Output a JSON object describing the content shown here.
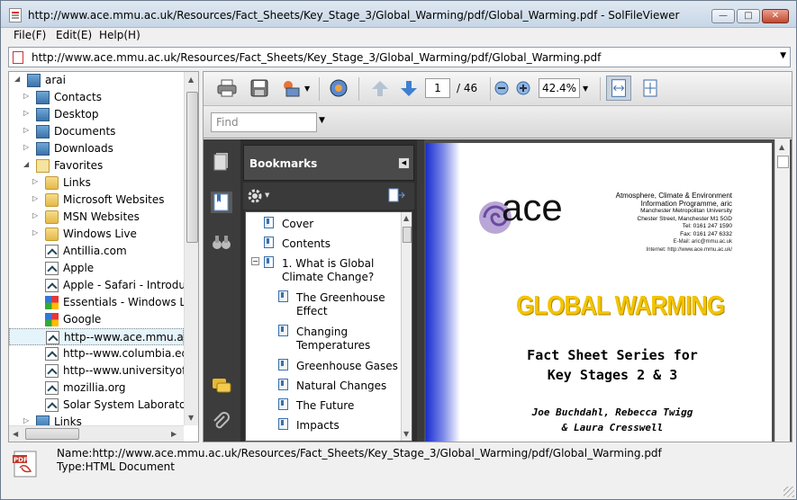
{
  "window": {
    "title": "http://www.ace.mmu.ac.uk/Resources/Fact_Sheets/Key_Stage_3/Global_Warming/pdf/Global_Warming.pdf - SolFileViewer"
  },
  "menu": [
    "File(F)",
    "Edit(E)",
    "Help(H)"
  ],
  "address": {
    "value": "http://www.ace.mmu.ac.uk/Resources/Fact_Sheets/Key_Stage_3/Global_Warming/pdf/Global_Warming.pdf"
  },
  "tree": {
    "items": [
      {
        "label": "arai",
        "icon": "user-icon"
      },
      {
        "label": "Contacts",
        "icon": "contacts-folder-icon"
      },
      {
        "label": "Desktop",
        "icon": "desktop-folder-icon"
      },
      {
        "label": "Documents",
        "icon": "documents-folder-icon"
      },
      {
        "label": "Downloads",
        "icon": "downloads-folder-icon"
      },
      {
        "label": "Favorites",
        "icon": "favorites-folder-icon"
      },
      {
        "label": "Links",
        "icon": "folder-icon"
      },
      {
        "label": "Microsoft Websites",
        "icon": "folder-icon"
      },
      {
        "label": "MSN Websites",
        "icon": "folder-icon"
      },
      {
        "label": "Windows Live",
        "icon": "folder-icon"
      },
      {
        "label": "Antillia.com",
        "icon": "shortcut-icon"
      },
      {
        "label": "Apple",
        "icon": "shortcut-icon"
      },
      {
        "label": "Apple - Safari - Introducir",
        "icon": "shortcut-icon"
      },
      {
        "label": "Essentials - Windows Live",
        "icon": "windows-shortcut-icon"
      },
      {
        "label": "Google",
        "icon": "google-shortcut-icon"
      },
      {
        "label": "http--www.ace.mmu.ac.u",
        "icon": "shortcut-icon"
      },
      {
        "label": "http--www.columbia.edu",
        "icon": "shortcut-icon"
      },
      {
        "label": "http--www.universityofca",
        "icon": "shortcut-icon"
      },
      {
        "label": "mozillia.org",
        "icon": "shortcut-icon"
      },
      {
        "label": "Solar System Laboratory",
        "icon": "shortcut-icon"
      },
      {
        "label": "Links",
        "icon": "links-folder-icon"
      }
    ]
  },
  "viewer": {
    "page_current": "1",
    "page_total": "/ 46",
    "zoom": "42.4%",
    "find_placeholder": "Find",
    "bookmarks_title": "Bookmarks",
    "bookmarks": [
      "Cover",
      "Contents",
      "1. What is Global Climate Change?",
      "The Greenhouse Effect",
      "Changing Temperatures",
      "Greenhouse Gases",
      "Natural Changes",
      "The Future",
      "Impacts"
    ]
  },
  "document": {
    "logo_text": "ace",
    "org_lines": [
      "Atmosphere, Climate & Environment",
      "Information Programme, aric",
      "Manchester Metropolitan University",
      "Chester Street, Manchester M1 5GD",
      "Tel: 0161 247 1590",
      "Fax: 0161 247 6332",
      "E-Mail: aric@mmu.ac.uk",
      "Internet: http://www.ace.mmu.ac.uk/"
    ],
    "headline": "GLOBAL WARMING",
    "subtitle1": "Fact Sheet Series for",
    "subtitle2": "Key Stages 2 & 3",
    "authors1": "Joe Buchdahl, Rebecca Twigg",
    "authors2": "& Laura Cresswell"
  },
  "status": {
    "name": "Name:http://www.ace.mmu.ac.uk/Resources/Fact_Sheets/Key_Stage_3/Global_Warming/pdf/Global_Warming.pdf",
    "type": "Type:HTML Document",
    "icon_label": "PDF"
  },
  "colors": {
    "accent": "#3b6fa8",
    "headline": "#f2c400",
    "page_edge": "#1a2fd0"
  }
}
